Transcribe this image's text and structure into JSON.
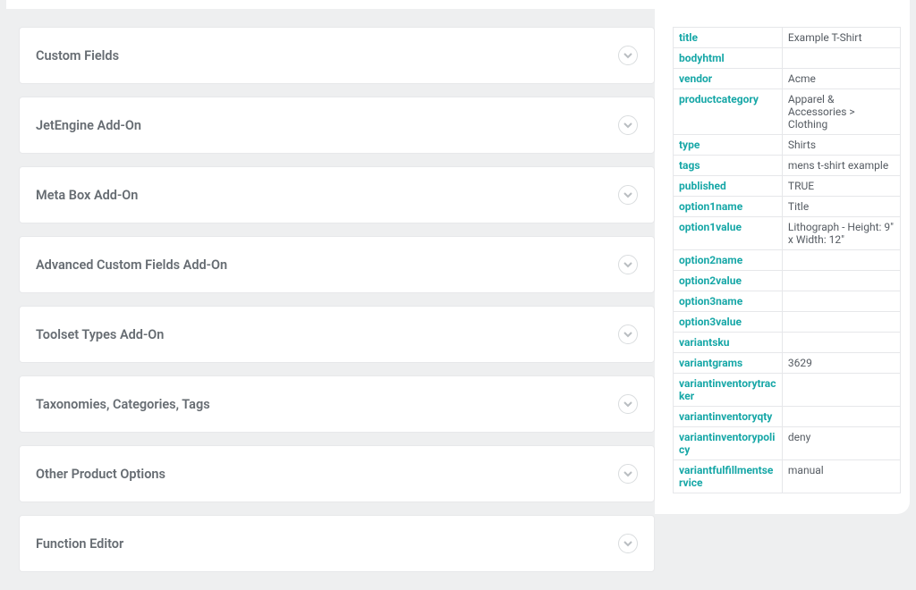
{
  "accordion": {
    "items": [
      {
        "label": "Custom Fields"
      },
      {
        "label": "JetEngine Add-On"
      },
      {
        "label": "Meta Box Add-On"
      },
      {
        "label": "Advanced Custom Fields Add-On"
      },
      {
        "label": "Toolset Types Add-On"
      },
      {
        "label": "Taxonomies, Categories, Tags"
      },
      {
        "label": "Other Product Options"
      },
      {
        "label": "Function Editor"
      }
    ]
  },
  "preview_table": {
    "rows": [
      {
        "key": "title",
        "value": "Example T-Shirt"
      },
      {
        "key": "bodyhtml",
        "value": ""
      },
      {
        "key": "vendor",
        "value": "Acme"
      },
      {
        "key": "productcategory",
        "value": "Apparel & Accessories > Clothing"
      },
      {
        "key": "type",
        "value": "Shirts"
      },
      {
        "key": "tags",
        "value": "mens t-shirt example"
      },
      {
        "key": "published",
        "value": "TRUE"
      },
      {
        "key": "option1name",
        "value": "Title"
      },
      {
        "key": "option1value",
        "value": "Lithograph - Height: 9\" x Width: 12\""
      },
      {
        "key": "option2name",
        "value": ""
      },
      {
        "key": "option2value",
        "value": ""
      },
      {
        "key": "option3name",
        "value": ""
      },
      {
        "key": "option3value",
        "value": ""
      },
      {
        "key": "variantsku",
        "value": ""
      },
      {
        "key": "variantgrams",
        "value": "3629"
      },
      {
        "key": "variantinventorytracker",
        "value": ""
      },
      {
        "key": "variantinventoryqty",
        "value": ""
      },
      {
        "key": "variantinventorypolicy",
        "value": "deny"
      },
      {
        "key": "variantfulfillmentservice",
        "value": "manual"
      }
    ]
  }
}
